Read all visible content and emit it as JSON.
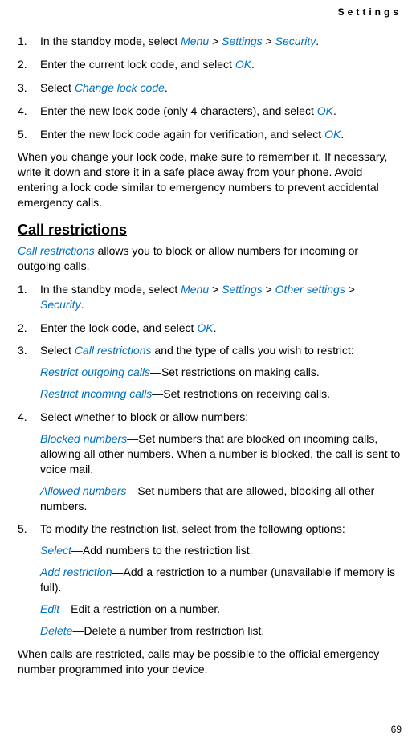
{
  "header": {
    "section": "Settings",
    "page": "69"
  },
  "intro_list": [
    {
      "pre": "In the standby mode, select ",
      "m1": "Menu",
      "s1": " > ",
      "m2": "Settings",
      "s2": " > ",
      "m3": "Security",
      "post": "."
    },
    {
      "pre": "Enter the current lock code, and select ",
      "m1": "OK",
      "post": "."
    },
    {
      "pre": "Select ",
      "m1": "Change lock code",
      "post": "."
    },
    {
      "pre": "Enter the new lock code (only 4 characters), and select ",
      "m1": "OK",
      "post": "."
    },
    {
      "pre": "Enter the new lock code again for verification, and select ",
      "m1": "OK",
      "post": "."
    }
  ],
  "intro_para": "When you change your lock code, make sure to remember it. If necessary, write it down and store it in a safe place away from your phone. Avoid entering a lock code similar to emergency numbers to prevent accidental emergency calls.",
  "section": {
    "heading": "Call restrictions",
    "lead_term": "Call restrictions",
    "lead_rest": " allows you to block or allow numbers for incoming or outgoing calls."
  },
  "main_list": {
    "i1": {
      "pre": "In the standby mode, select ",
      "m1": "Menu",
      "s1": " > ",
      "m2": "Settings",
      "s2": " > ",
      "m3": "Other settings",
      "s3": " > ",
      "m4": "Security",
      "post": "."
    },
    "i2": {
      "pre": "Enter the lock code, and select ",
      "m1": "OK",
      "post": "."
    },
    "i3": {
      "pre": "Select ",
      "m1": "Call restrictions",
      "post": " and the type of calls you wish to restrict:"
    },
    "i3a": {
      "term": "Restrict outgoing calls",
      "rest": "—Set restrictions on making calls."
    },
    "i3b": {
      "term": "Restrict incoming calls",
      "rest": "—Set restrictions on receiving calls."
    },
    "i4": "Select whether to block or allow numbers:",
    "i4a": {
      "term": "Blocked numbers",
      "rest": "—Set numbers that are blocked on incoming calls, allowing all other numbers. When a number is blocked, the call is sent to voice mail."
    },
    "i4b": {
      "term": "Allowed numbers",
      "rest": "—Set numbers that are allowed, blocking all other numbers."
    },
    "i5": "To modify the restriction list, select from the following options:",
    "i5a": {
      "term": "Select",
      "rest": "—Add numbers to the restriction list."
    },
    "i5b": {
      "term": "Add restriction",
      "rest": "—Add a restriction to a number (unavailable if memory is full)."
    },
    "i5c": {
      "term": "Edit",
      "rest": "—Edit a restriction on a number."
    },
    "i5d": {
      "term": "Delete",
      "rest": "—Delete a number from restriction list."
    }
  },
  "outro": "When calls are restricted, calls may be possible to the official emergency number programmed into your device."
}
